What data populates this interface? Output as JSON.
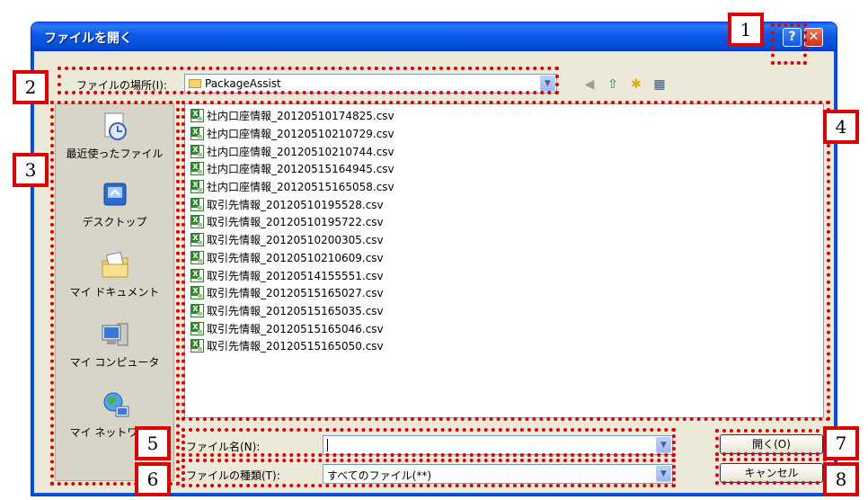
{
  "title": "ファイルを開く",
  "titlebar": {
    "help_symbol": "?",
    "close_symbol": "✕"
  },
  "lookin": {
    "label": "ファイルの場所(I):",
    "value": "PackageAssist"
  },
  "places": [
    {
      "label": "最近使ったファイル",
      "icon": "recent-icon"
    },
    {
      "label": "デスクトップ",
      "icon": "desktop-icon"
    },
    {
      "label": "マイ ドキュメント",
      "icon": "my-documents-icon"
    },
    {
      "label": "マイ コンピュータ",
      "icon": "my-computer-icon"
    },
    {
      "label": "マイ ネットワーク",
      "icon": "my-network-icon"
    }
  ],
  "files": [
    "社内口座情報_20120510174825.csv",
    "社内口座情報_20120510210729.csv",
    "社内口座情報_20120510210744.csv",
    "社内口座情報_20120515164945.csv",
    "社内口座情報_20120515165058.csv",
    "取引先情報_20120510195528.csv",
    "取引先情報_20120510195722.csv",
    "取引先情報_20120510200305.csv",
    "取引先情報_20120510210609.csv",
    "取引先情報_20120514155551.csv",
    "取引先情報_20120515165027.csv",
    "取引先情報_20120515165035.csv",
    "取引先情報_20120515165046.csv",
    "取引先情報_20120515165050.csv"
  ],
  "filename": {
    "label": "ファイル名(N):",
    "value": ""
  },
  "filetype": {
    "label": "ファイルの種類(T):",
    "value": "すべてのファイル(**)"
  },
  "buttons": {
    "open": "開く(O)",
    "cancel": "キャンセル"
  },
  "callouts": [
    "1",
    "2",
    "3",
    "4",
    "5",
    "6",
    "7",
    "8"
  ],
  "colors": {
    "highlight": "#e10000",
    "titlebar": "#0054e3",
    "dialog_bg": "#ece9d8"
  }
}
